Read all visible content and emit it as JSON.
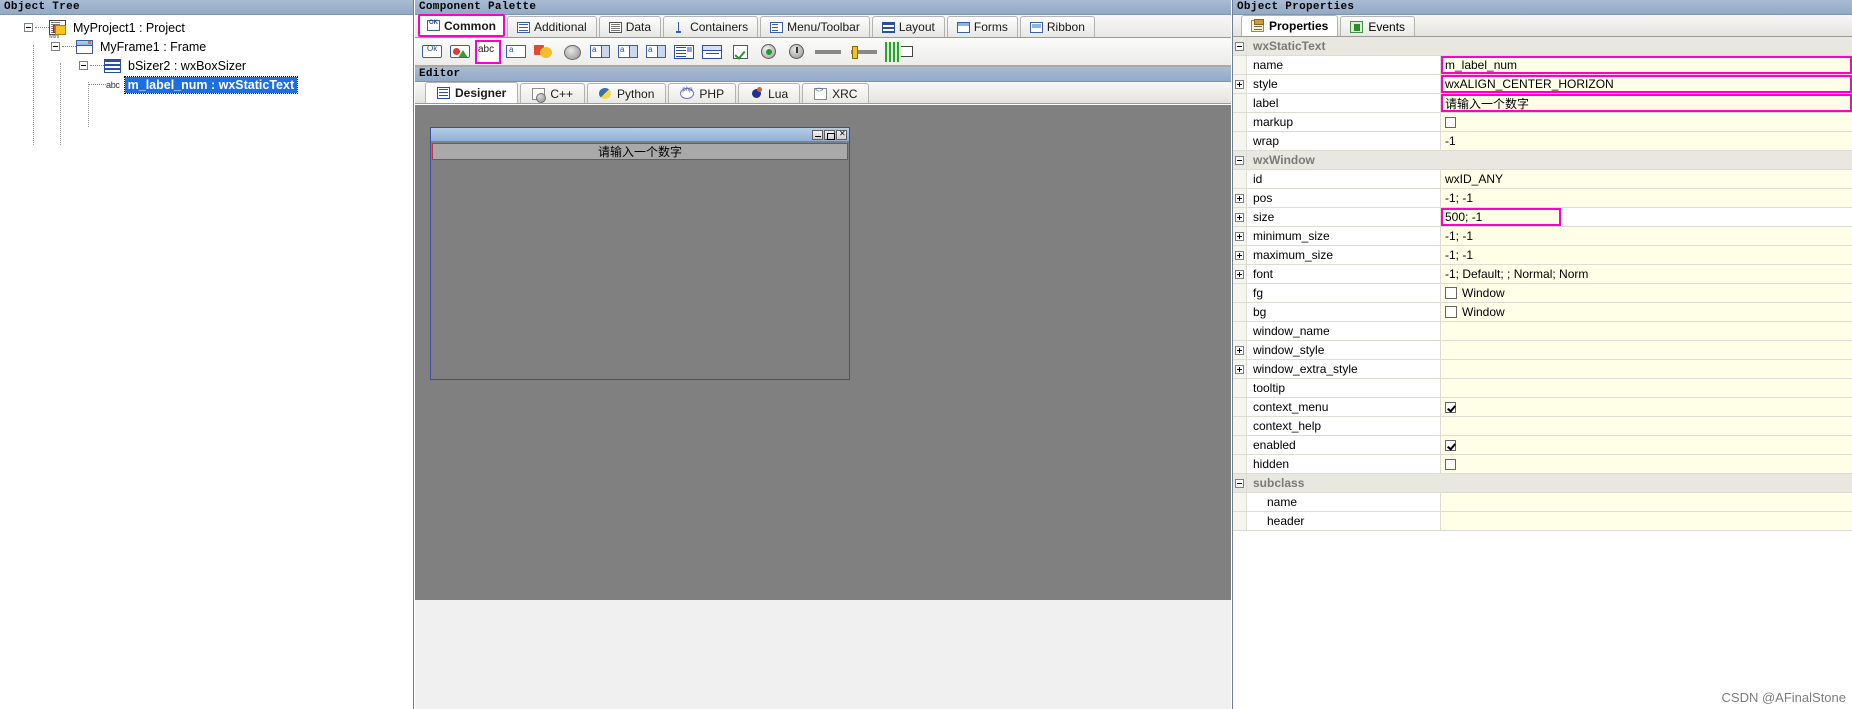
{
  "object_tree": {
    "caption": "Object Tree",
    "nodes": [
      {
        "label": "MyProject1 : Project",
        "icon": "project-icon",
        "indent": 0,
        "expander": "minus",
        "selected": false
      },
      {
        "label": "MyFrame1 : Frame",
        "icon": "frame-icon",
        "indent": 1,
        "expander": "minus",
        "selected": false
      },
      {
        "label": "bSizer2 : wxBoxSizer",
        "icon": "boxsizer-icon",
        "indent": 2,
        "expander": "minus",
        "selected": false
      },
      {
        "label": "m_label_num : wxStaticText",
        "icon": "statictext-abc-icon",
        "indent": 3,
        "expander": "none",
        "selected": true
      }
    ]
  },
  "component_palette": {
    "caption": "Component Palette",
    "tabs": [
      {
        "label": "Common",
        "icon": "common-icon",
        "active": true
      },
      {
        "label": "Additional",
        "icon": "additional-icon",
        "active": false
      },
      {
        "label": "Data",
        "icon": "data-icon",
        "active": false
      },
      {
        "label": "Containers",
        "icon": "containers-icon",
        "active": false
      },
      {
        "label": "Menu/Toolbar",
        "icon": "menu-toolbar-icon",
        "active": false
      },
      {
        "label": "Layout",
        "icon": "layout-icon",
        "active": false
      },
      {
        "label": "Forms",
        "icon": "forms-icon",
        "active": false
      },
      {
        "label": "Ribbon",
        "icon": "ribbon-icon",
        "active": false
      }
    ],
    "tools": [
      {
        "name": "wxButton",
        "icon": "ok-button-icon",
        "highlighted": false
      },
      {
        "name": "wxBitmapButton",
        "icon": "bitmap-button-icon",
        "highlighted": false
      },
      {
        "name": "wxStaticText",
        "icon": "abc-statictext-icon",
        "highlighted": true
      },
      {
        "name": "wxTextCtrl",
        "icon": "textctrl-icon",
        "highlighted": false
      },
      {
        "name": "wxStaticBitmap",
        "icon": "static-bitmap-icon",
        "highlighted": false
      },
      {
        "name": "wxStaticLine",
        "icon": "static-line-icon",
        "highlighted": false
      },
      {
        "name": "wxComboBox",
        "icon": "combobox-icon",
        "highlighted": false
      },
      {
        "name": "wxChoice",
        "icon": "choice-icon",
        "highlighted": false
      },
      {
        "name": "wxBitmapComboBox",
        "icon": "bitmap-combobox-icon",
        "highlighted": false
      },
      {
        "name": "wxListBox",
        "icon": "listbox-icon",
        "highlighted": false
      },
      {
        "name": "wxPanel",
        "icon": "panel-icon",
        "highlighted": false
      },
      {
        "name": "wxCheckBox",
        "icon": "checkbox-icon",
        "highlighted": false
      },
      {
        "name": "wxRadioButton",
        "icon": "radio-button-icon",
        "highlighted": false
      },
      {
        "name": "wxSpinCtrl",
        "icon": "spin-ctrl-icon",
        "highlighted": false
      },
      {
        "name": "wxSlider",
        "icon": "slider-icon",
        "highlighted": false
      },
      {
        "name": "wxScrollBar",
        "icon": "scrollbar-icon",
        "highlighted": false
      },
      {
        "name": "wxGauge",
        "icon": "gauge-icon",
        "highlighted": false
      }
    ]
  },
  "editor": {
    "caption": "Editor",
    "tabs": [
      {
        "label": "Designer",
        "icon": "designer-icon",
        "active": true
      },
      {
        "label": "C++",
        "icon": "cpp-icon",
        "active": false
      },
      {
        "label": "Python",
        "icon": "python-icon",
        "active": false
      },
      {
        "label": "PHP",
        "icon": "php-icon",
        "active": false
      },
      {
        "label": "Lua",
        "icon": "lua-icon",
        "active": false
      },
      {
        "label": "XRC",
        "icon": "xrc-icon",
        "active": false
      }
    ],
    "design_form": {
      "static_text_label": "请输入一个数字",
      "window_buttons": [
        "minimize",
        "maximize",
        "close"
      ]
    }
  },
  "object_properties": {
    "caption": "Object Properties",
    "tabs": [
      {
        "label": "Properties",
        "icon": "properties-icon",
        "active": true
      },
      {
        "label": "Events",
        "icon": "events-icon",
        "active": false
      }
    ],
    "rows": [
      {
        "kind": "category",
        "name": "wxStaticText",
        "value": "",
        "expander": "minus"
      },
      {
        "kind": "prop",
        "name": "name",
        "value": "m_label_num",
        "expander": "none",
        "value_highlight": true
      },
      {
        "kind": "prop",
        "name": "style",
        "value": "wxALIGN_CENTER_HORIZON",
        "expander": "plus",
        "value_highlight": true
      },
      {
        "kind": "prop",
        "name": "label",
        "value": "请输入一个数字",
        "expander": "none",
        "value_highlight": true
      },
      {
        "kind": "prop",
        "name": "markup",
        "value": "",
        "expander": "none",
        "control": "checkbox",
        "checked": false
      },
      {
        "kind": "prop",
        "name": "wrap",
        "value": "-1",
        "expander": "none"
      },
      {
        "kind": "category",
        "name": "wxWindow",
        "value": "",
        "expander": "minus"
      },
      {
        "kind": "prop",
        "name": "id",
        "value": "wxID_ANY",
        "expander": "none"
      },
      {
        "kind": "prop",
        "name": "pos",
        "value": "-1; -1",
        "expander": "plus"
      },
      {
        "kind": "prop",
        "name": "size",
        "value": "500; -1",
        "expander": "plus",
        "value_highlight": true
      },
      {
        "kind": "prop",
        "name": "minimum_size",
        "value": "-1; -1",
        "expander": "plus"
      },
      {
        "kind": "prop",
        "name": "maximum_size",
        "value": "-1; -1",
        "expander": "plus"
      },
      {
        "kind": "prop",
        "name": "font",
        "value": "-1; Default; ; Normal; Norm",
        "expander": "plus"
      },
      {
        "kind": "prop",
        "name": "fg",
        "value": "Window",
        "expander": "none",
        "control": "swatch"
      },
      {
        "kind": "prop",
        "name": "bg",
        "value": "Window",
        "expander": "none",
        "control": "swatch"
      },
      {
        "kind": "prop",
        "name": "window_name",
        "value": "",
        "expander": "none"
      },
      {
        "kind": "prop",
        "name": "window_style",
        "value": "",
        "expander": "plus"
      },
      {
        "kind": "prop",
        "name": "window_extra_style",
        "value": "",
        "expander": "plus"
      },
      {
        "kind": "prop",
        "name": "tooltip",
        "value": "",
        "expander": "none"
      },
      {
        "kind": "prop",
        "name": "context_menu",
        "value": "",
        "expander": "none",
        "control": "checkbox",
        "checked": true
      },
      {
        "kind": "prop",
        "name": "context_help",
        "value": "",
        "expander": "none"
      },
      {
        "kind": "prop",
        "name": "enabled",
        "value": "",
        "expander": "none",
        "control": "checkbox",
        "checked": true
      },
      {
        "kind": "prop",
        "name": "hidden",
        "value": "",
        "expander": "none",
        "control": "checkbox",
        "checked": false
      },
      {
        "kind": "category",
        "name": "subclass",
        "value": "",
        "expander": "minus"
      },
      {
        "kind": "sub",
        "name": "name",
        "value": "",
        "expander": "none"
      },
      {
        "kind": "sub",
        "name": "header",
        "value": "",
        "expander": "none"
      }
    ]
  },
  "watermark": "CSDN @AFinalStone",
  "colors": {
    "caption_bar": "#9cb2cc",
    "highlight_magenta": "#ff00cc",
    "selection_blue": "#1c6fe0",
    "value_cell_yellow": "#ffffe8",
    "canvas_gray": "#808080",
    "label_border_red": "#c0392b"
  }
}
